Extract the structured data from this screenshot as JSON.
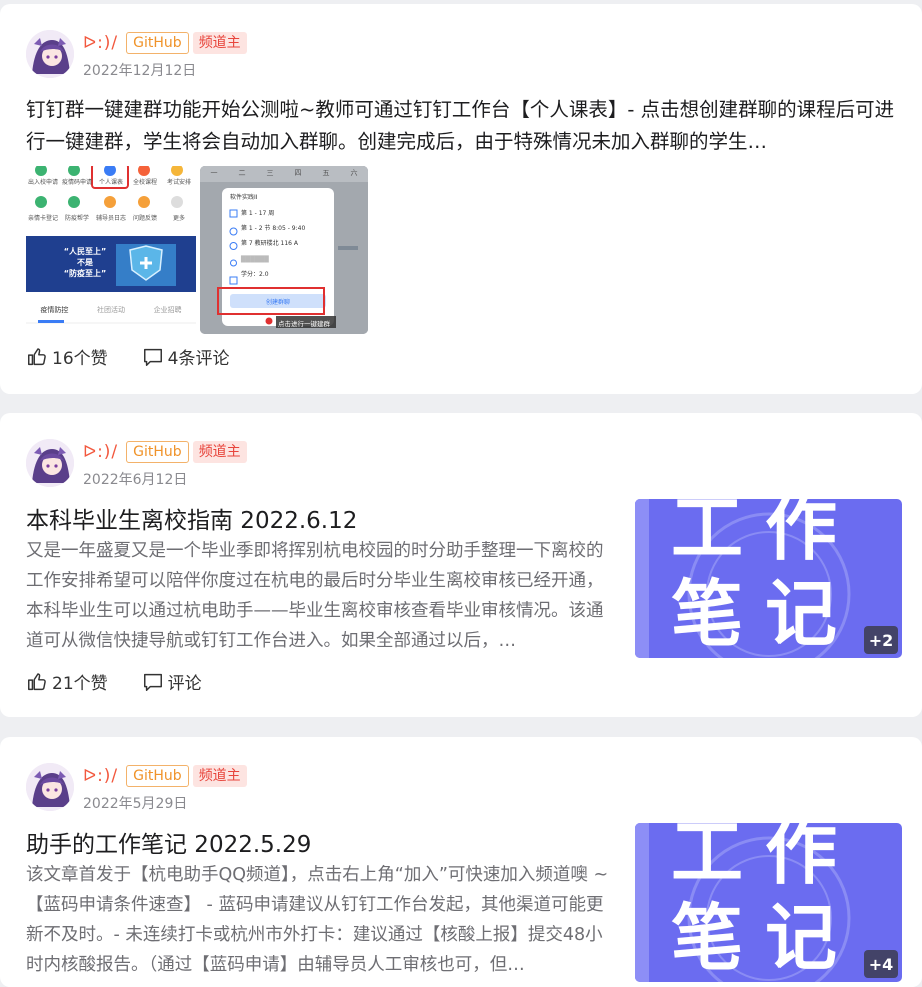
{
  "posts": [
    {
      "author": "ᐅ:)/",
      "badge_github": "GitHub",
      "badge_role": "频道主",
      "date": "2022年12月12日",
      "title": "钉钉群一键建群功能开始公测啦~教师可通过钉钉工作台【个人课表】- 点击想创建群聊的课程后可进行一键建群，学生将会自动加入群聊。创建完成后，由于特殊情况未加入群聊的学生…",
      "likes": "16个赞",
      "comments": "4条评论",
      "screenshot_a": {
        "menu_items": [
          "出入校申请",
          "疫情码申请",
          "个人课表",
          "全校课程",
          "考试安排",
          "亲情卡登记",
          "防疫帮学",
          "辅导员日志",
          "问题反馈",
          "更多"
        ],
        "banner_line1": "“人民至上”",
        "banner_line2": "不是",
        "banner_line3": "“防疫至上”",
        "tabs": [
          "疫情防控",
          "社团活动",
          "企业招聘"
        ]
      },
      "screenshot_b": {
        "weekdays": [
          "一",
          "二",
          "三",
          "四",
          "五",
          "六"
        ],
        "course": "软件实践II",
        "week": "第 1 - 17 周",
        "time": "第 1 - 2 节 8:05 - 9:40",
        "place": "第 7 教研楼北 116 A",
        "teacher": "██████",
        "credit": "学分：2.0",
        "create_group": "创建群聊",
        "tip": "点击进行一键建群"
      }
    },
    {
      "author": "ᐅ:)/",
      "badge_github": "GitHub",
      "badge_role": "频道主",
      "date": "2022年6月12日",
      "title": "本科毕业生离校指南 2022.6.12",
      "excerpt": "又是一年盛夏又是一个毕业季即将挥别杭电校园的时分助手整理一下离校的工作安排希望可以陪伴你度过在杭电的最后时分毕业生离校审核已经开通，本科毕业生可以通过杭电助手——毕业生离校审核查看毕业审核情况。该通道可从微信快捷导航或钉钉工作台进入。如果全部通过以后，…",
      "likes": "21个赞",
      "comments": "评论",
      "image_text_1": "工作",
      "image_text_2": "笔记",
      "more_count": "+2"
    },
    {
      "author": "ᐅ:)/",
      "badge_github": "GitHub",
      "badge_role": "频道主",
      "date": "2022年5月29日",
      "title": "助手的工作笔记 2022.5.29",
      "excerpt": "该文章首发于【杭电助手QQ频道】，点击右上角“加入”可快速加入频道噢 ~ 【蓝码申请条件速查】 - 蓝码申请建议从钉钉工作台发起，其他渠道可能更新不及时。- 未连续打卡或杭州市外打卡：建议通过【核酸上报】提交48小时内核酸报告。（通过【蓝码申请】由辅导员人工审核也可，但…",
      "image_text_1": "工作",
      "image_text_2": "笔记",
      "more_count": "+4"
    }
  ],
  "colors": {
    "author": "#f2583e",
    "github_tag": "#f0932a",
    "role_tag": "#e8453c",
    "note_bg": "#6b6cf0"
  }
}
